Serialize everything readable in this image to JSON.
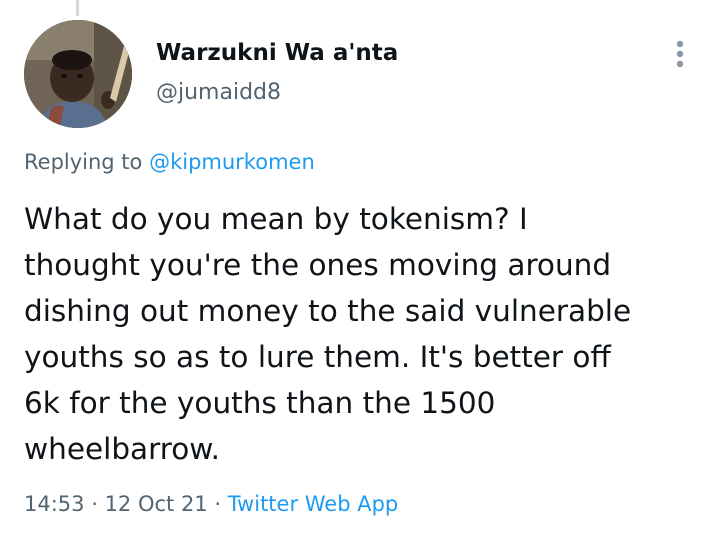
{
  "author": {
    "display_name": "Warzukni Wa a'nta",
    "handle": "@jumaidd8"
  },
  "reply_context": {
    "prefix": "Replying to ",
    "mention": "@kipmurkomen"
  },
  "tweet": {
    "lines": [
      "What do you mean by tokenism? I",
      "thought you're the ones moving around",
      "dishing out money to the said vulnerable",
      "youths so as to lure them. It's better off",
      "6k for the youths than the 1500",
      "wheelbarrow."
    ]
  },
  "meta": {
    "time": "14:53",
    "separator_1": " · ",
    "date": "12 Oct 21",
    "separator_2": " · ",
    "source": "Twitter Web App"
  },
  "icons": {
    "more": "more-vertical-icon"
  },
  "colors": {
    "link": "#1d9bf0",
    "secondary_text": "#536471",
    "primary_text": "#0f1419"
  }
}
